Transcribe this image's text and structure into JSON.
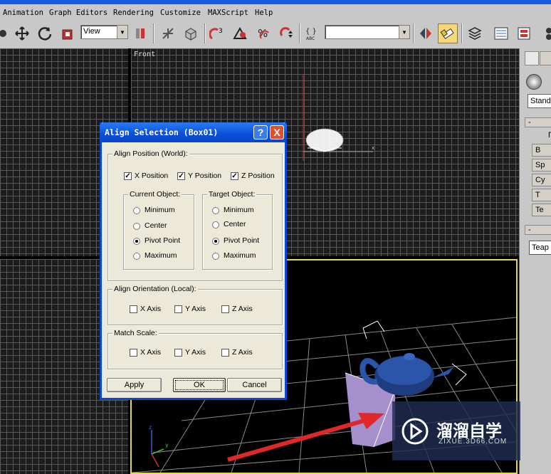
{
  "menu": {
    "items": [
      "Animation",
      "Graph Editors",
      "Rendering",
      "Customize",
      "MAXScript",
      "Help"
    ]
  },
  "toolbar": {
    "coord_system": "View",
    "selection_set": "",
    "icons": [
      "select-move-icon",
      "rotate-icon",
      "scale-icon",
      "view-dropdown",
      "pivot-icon",
      "link-icon",
      "bind-icon",
      "snap-3-icon",
      "angle-snap-icon",
      "percent-snap-icon",
      "spinner-snap-icon",
      "abc-icon",
      "mirror-icon",
      "align-icon",
      "layers-icon",
      "curve-editor-icon",
      "schematic-icon"
    ],
    "snap_label": "3"
  },
  "viewports": {
    "front_label": "Front"
  },
  "command_panel": {
    "dropdown": "Stand",
    "rollout1_label": "-",
    "buttons": [
      "Γ",
      "B",
      "Sp",
      "Cy",
      "T",
      "Te"
    ],
    "rollout2_label": "-",
    "name_field": "Teap"
  },
  "dialog": {
    "title": "Align Selection (Box01)",
    "help_btn": "?",
    "close_btn": "X",
    "align_position": {
      "label": "Align Position (World):",
      "x": {
        "label": "X Position",
        "checked": true
      },
      "y": {
        "label": "Y Position",
        "checked": true
      },
      "z": {
        "label": "Z Position",
        "checked": true
      }
    },
    "current_object": {
      "label": "Current Object:",
      "options": [
        "Minimum",
        "Center",
        "Pivot Point",
        "Maximum"
      ],
      "selected": "Pivot Point"
    },
    "target_object": {
      "label": "Target Object:",
      "options": [
        "Minimum",
        "Center",
        "Pivot Point",
        "Maximum"
      ],
      "selected": "Pivot Point"
    },
    "align_orientation": {
      "label": "Align Orientation (Local):",
      "x": "X Axis",
      "y": "Y Axis",
      "z": "Z Axis"
    },
    "match_scale": {
      "label": "Match Scale:",
      "x": "X Axis",
      "y": "Y Axis",
      "z": "Z Axis"
    },
    "buttons": {
      "apply": "Apply",
      "ok": "OK",
      "cancel": "Cancel"
    }
  },
  "watermark": {
    "title": "溜溜自学",
    "url": "ZIXUE.3D66.COM"
  },
  "colors": {
    "titlebar": "#0a4ed8",
    "dialog_bg": "#ece9d8",
    "active_viewport_border": "#e8d84a",
    "arrow": "#e02828"
  }
}
